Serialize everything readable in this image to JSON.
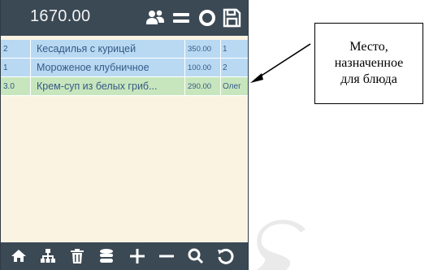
{
  "header": {
    "total": "1670.00",
    "icons": [
      "people-icon",
      "menu-icon",
      "settings-icon",
      "save-icon"
    ]
  },
  "orders": {
    "rows": [
      {
        "seat": "2",
        "name": "Кесадилья с курицей",
        "price": "350.00",
        "extra": "1",
        "color": "#b9d9f3"
      },
      {
        "seat": "1",
        "name": "Мороженое клубничное",
        "price": "100.00",
        "extra": "2",
        "color": "#b9d9f3"
      },
      {
        "seat": "3.0",
        "name": "Крем-суп из белых гриб...",
        "price": "290.00",
        "extra": "Олег",
        "color": "#c8e6bd"
      }
    ]
  },
  "footer": {
    "icons": [
      "home-icon",
      "hierarchy-icon",
      "trash-icon",
      "database-icon",
      "plus-icon",
      "minus-icon",
      "search-icon",
      "undo-icon"
    ]
  },
  "callout": {
    "lines": [
      "Место,",
      "назначенное",
      "для блюда"
    ]
  },
  "colors": {
    "bar": "#3b4955",
    "background": "#fbf3e2",
    "row_blue": "#b9d9f3",
    "row_green": "#c8e6bd",
    "row_text": "#355a86"
  }
}
